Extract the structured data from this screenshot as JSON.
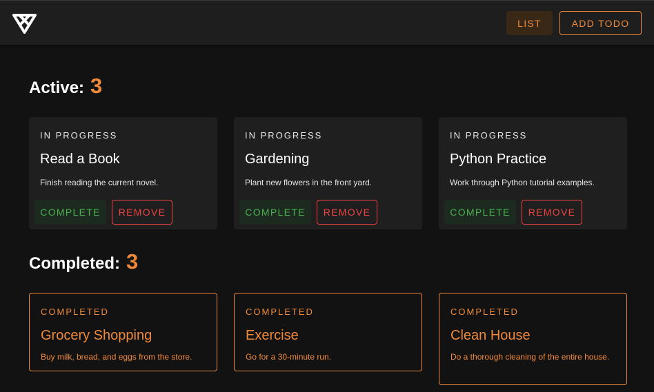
{
  "header": {
    "logo_icon": "triangle-logo-icon",
    "nav": {
      "list_label": "LIST",
      "add_label": "ADD TODO"
    }
  },
  "colors": {
    "background": "#121212",
    "appbar": "#1e1e1e",
    "accent": "#f08a3a",
    "success": "#4caf50",
    "danger": "#ef4444"
  },
  "active": {
    "label": "Active:",
    "count": "3",
    "items": [
      {
        "status": "IN PROGRESS",
        "title": "Read a Book",
        "description": "Finish reading the current novel.",
        "complete_label": "COMPLETE",
        "remove_label": "REMOVE"
      },
      {
        "status": "IN PROGRESS",
        "title": "Gardening",
        "description": "Plant new flowers in the front yard.",
        "complete_label": "COMPLETE",
        "remove_label": "REMOVE"
      },
      {
        "status": "IN PROGRESS",
        "title": "Python Practice",
        "description": "Work through Python tutorial examples.",
        "complete_label": "COMPLETE",
        "remove_label": "REMOVE"
      }
    ]
  },
  "completed": {
    "label": "Completed:",
    "count": "3",
    "items": [
      {
        "status": "COMPLETED",
        "title": "Grocery Shopping",
        "description": "Buy milk, bread, and eggs from the store."
      },
      {
        "status": "COMPLETED",
        "title": "Exercise",
        "description": "Go for a 30-minute run."
      },
      {
        "status": "COMPLETED",
        "title": "Clean House",
        "description": "Do a thorough cleaning of the entire house."
      }
    ]
  }
}
